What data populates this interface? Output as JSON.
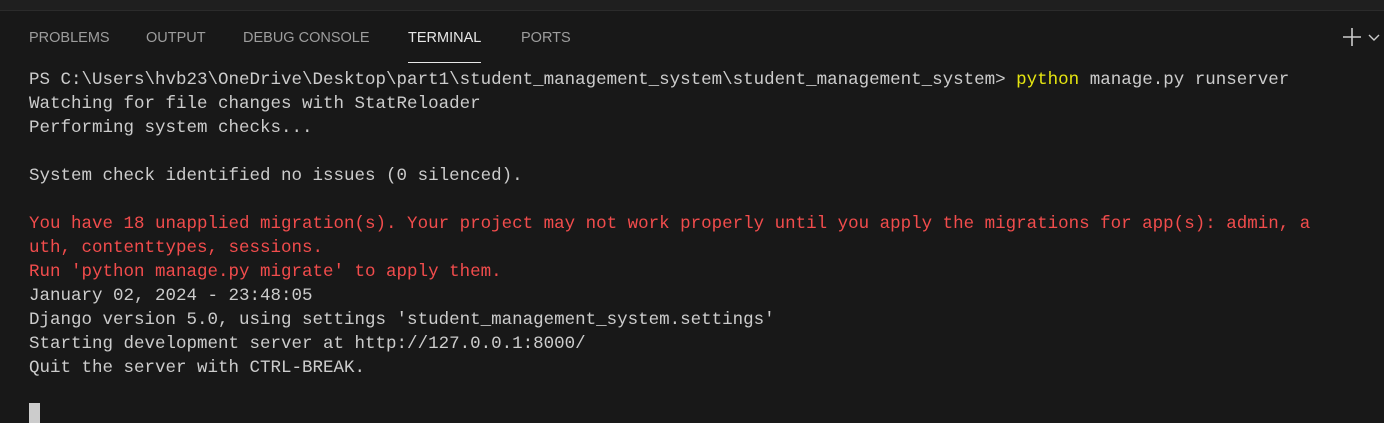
{
  "tabs": [
    {
      "label": "PROBLEMS",
      "active": false
    },
    {
      "label": "OUTPUT",
      "active": false
    },
    {
      "label": "DEBUG CONSOLE",
      "active": false
    },
    {
      "label": "TERMINAL",
      "active": true
    },
    {
      "label": "PORTS",
      "active": false
    }
  ],
  "actions": {
    "new_terminal_icon": "plus-icon",
    "launch_profile_icon": "chevron-down-icon"
  },
  "terminal": {
    "prompt": "PS C:\\Users\\hvb23\\OneDrive\\Desktop\\part1\\student_management_system\\student_management_system> ",
    "command_name": "python",
    "command_args": " manage.py runserver",
    "lines": [
      "Watching for file changes with StatReloader",
      "Performing system checks...",
      "",
      "System check identified no issues (0 silenced).",
      ""
    ],
    "warning_lines": [
      "You have 18 unapplied migration(s). Your project may not work properly until you apply the migrations for app(s): admin, a",
      "uth, contenttypes, sessions.",
      "Run 'python manage.py migrate' to apply them."
    ],
    "after_lines": [
      "January 02, 2024 - 23:48:05",
      "Django version 5.0, using settings 'student_management_system.settings'",
      "Starting development server at http://127.0.0.1:8000/",
      "Quit the server with CTRL-BREAK."
    ]
  },
  "colors": {
    "background": "#181818",
    "text": "#cccccc",
    "error": "#f14c4c",
    "command": "#e5e510",
    "active_tab": "#e7e7e7",
    "inactive_tab": "#9d9d9d"
  }
}
